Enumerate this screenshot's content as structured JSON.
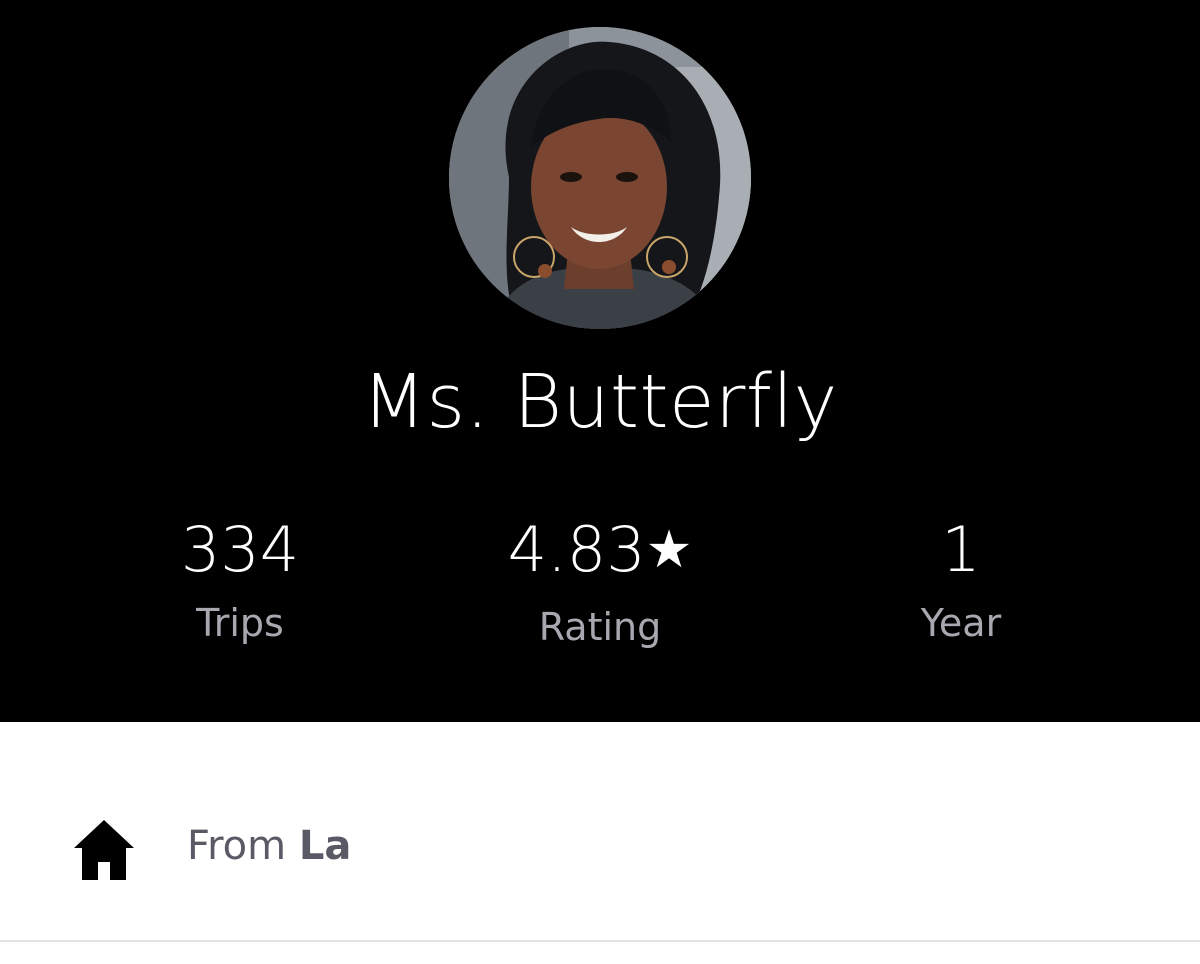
{
  "profile": {
    "name": "Ms. Butterfly",
    "avatar_description": "profile-photo"
  },
  "stats": {
    "trips": {
      "value": "334",
      "label": "Trips"
    },
    "rating": {
      "value": "4.83",
      "star": "★",
      "label": "Rating"
    },
    "years": {
      "value": "1",
      "label": "Year"
    }
  },
  "info": {
    "from_prefix": "From ",
    "from_city": "La",
    "icon": "home-icon"
  },
  "colors": {
    "header_bg": "#000000",
    "label_gray": "#a8a8b0",
    "text_gray": "#5a5a66"
  }
}
